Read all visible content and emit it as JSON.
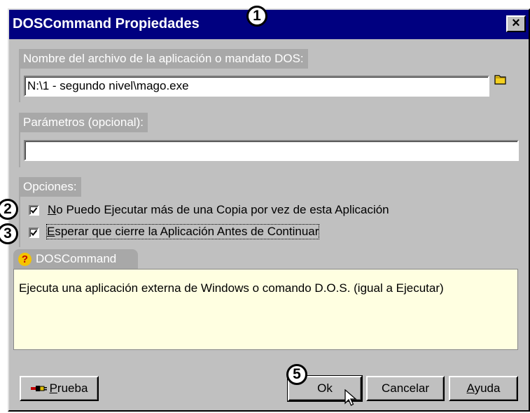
{
  "window": {
    "title": "DOSCommand Propiedades",
    "close_label": "×"
  },
  "app_file": {
    "label": "Nombre del archivo de la aplicación o mandato DOS:",
    "value": "N:\\1 - segundo nivel\\mago.exe",
    "browse_icon": "folder-icon"
  },
  "params": {
    "label": "Parámetros (opcional):",
    "value": ""
  },
  "options": {
    "label": "Opciones:",
    "items": [
      {
        "checked": true,
        "label_first": "N",
        "label_rest": "o Puedo Ejecutar más de una Copia por vez de esta Aplicación"
      },
      {
        "checked": true,
        "label_first": "E",
        "label_rest": "sperar que cierre la Aplicación Antes de Continuar"
      }
    ]
  },
  "help": {
    "icon": "question-icon",
    "icon_glyph": "?",
    "title": "DOSCommand",
    "text": "Ejecuta una aplicación externa de Windows o comando D.O.S. (igual a Ejecutar)"
  },
  "buttons": {
    "test_first": "P",
    "test_rest": "rueba",
    "test_icon": "plug-icon",
    "ok": "Ok",
    "cancel": "Cancelar",
    "help_first": "A",
    "help_rest": "yuda"
  },
  "callouts": [
    "1",
    "2",
    "3",
    "5"
  ],
  "colors": {
    "title_bar": "#000080",
    "window_bg": "#c0c0c0",
    "section_label_bg": "#a8a8a8",
    "help_bg": "#ffffe1"
  }
}
